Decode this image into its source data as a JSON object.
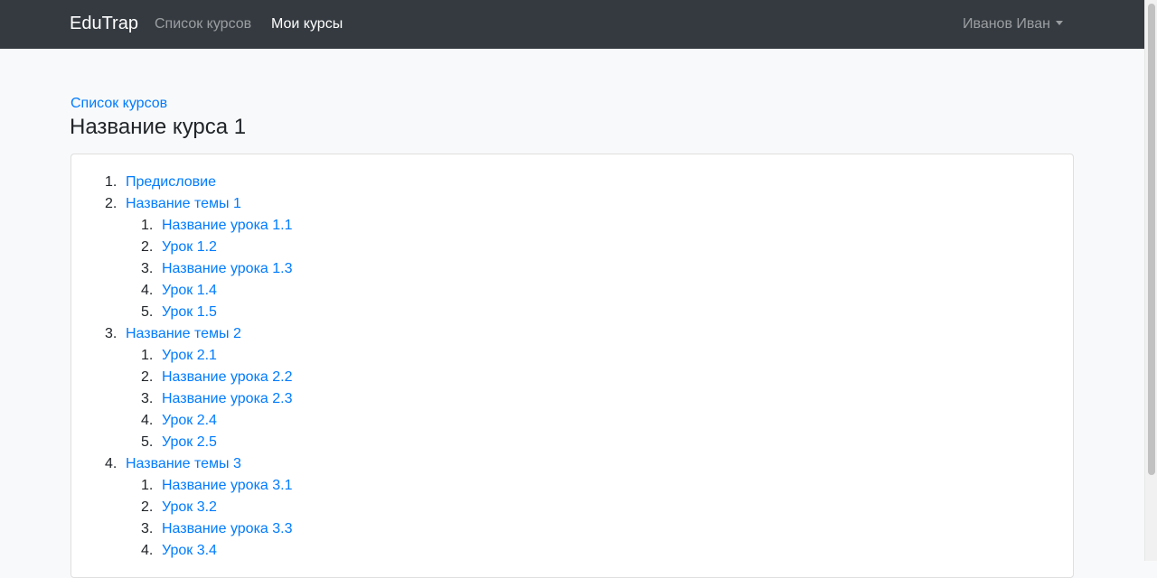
{
  "navbar": {
    "brand": "EduTrap",
    "links": [
      {
        "label": "Список курсов"
      },
      {
        "label": "Мои курсы"
      }
    ],
    "user": "Иванов Иван"
  },
  "breadcrumb": "Список курсов",
  "course_title": "Название курса 1",
  "toc": {
    "items": [
      {
        "num": "1.",
        "label": "Предисловие"
      },
      {
        "num": "2.",
        "label": "Название темы 1",
        "children": [
          {
            "num": "1.",
            "label": "Название урока 1.1"
          },
          {
            "num": "2.",
            "label": "Урок 1.2"
          },
          {
            "num": "3.",
            "label": "Название урока 1.3"
          },
          {
            "num": "4.",
            "label": "Урок 1.4"
          },
          {
            "num": "5.",
            "label": "Урок 1.5"
          }
        ]
      },
      {
        "num": "3.",
        "label": "Название темы 2",
        "children": [
          {
            "num": "1.",
            "label": "Урок 2.1"
          },
          {
            "num": "2.",
            "label": "Название урока 2.2"
          },
          {
            "num": "3.",
            "label": "Название урока 2.3"
          },
          {
            "num": "4.",
            "label": "Урок 2.4"
          },
          {
            "num": "5.",
            "label": "Урок 2.5"
          }
        ]
      },
      {
        "num": "4.",
        "label": "Название темы 3",
        "children": [
          {
            "num": "1.",
            "label": "Название урока 3.1"
          },
          {
            "num": "2.",
            "label": "Урок 3.2"
          },
          {
            "num": "3.",
            "label": "Название урока 3.3"
          },
          {
            "num": "4.",
            "label": "Урок 3.4"
          }
        ]
      }
    ]
  },
  "colors": {
    "navbar_bg": "#343a40",
    "link": "#007bff",
    "page_bg": "#f8f9fa"
  }
}
